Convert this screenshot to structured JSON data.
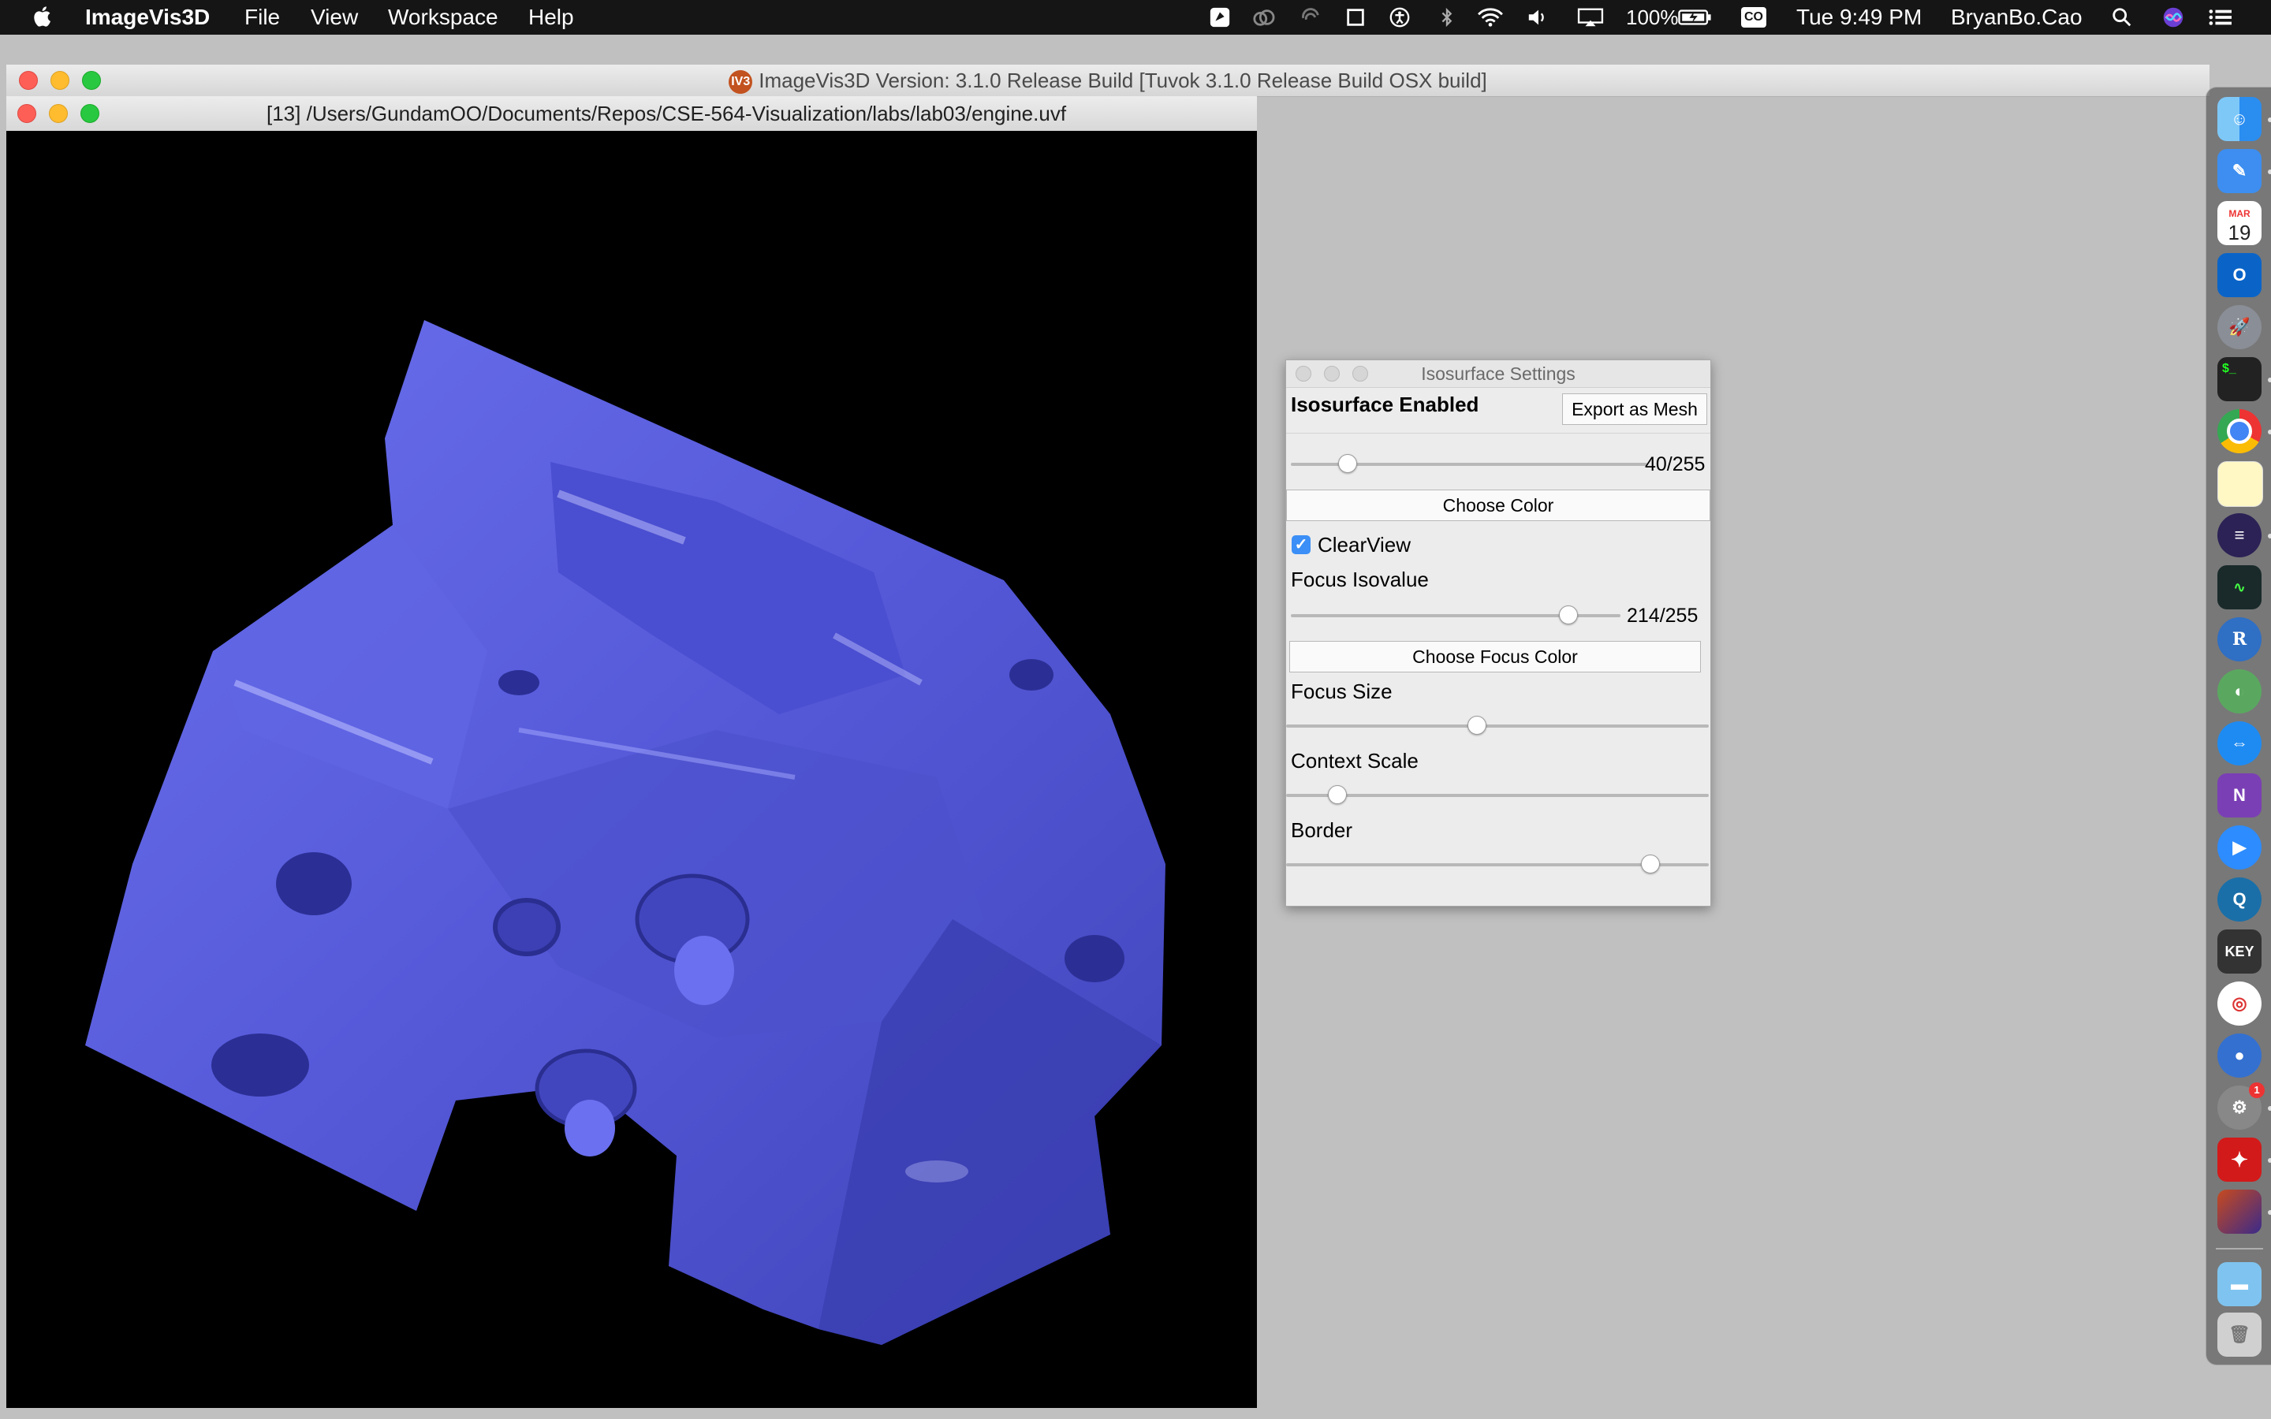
{
  "menubar": {
    "app_name": "ImageVis3D",
    "items": [
      "File",
      "View",
      "Workspace",
      "Help"
    ],
    "battery": "100%",
    "input_badge": "CO",
    "clock": "Tue 9:49 PM",
    "user": "BryanBo.Cao"
  },
  "main_window": {
    "title": "ImageVis3D Version: 3.1.0 Release Build [Tuvok 3.1.0 Release Build OSX build]",
    "logo_text": "IV3"
  },
  "render_window": {
    "title": "[13] /Users/GundamOO/Documents/Repos/CSE-564-Visualization/labs/lab03/engine.uvf",
    "surface_color": "#5b5fe0"
  },
  "iso_dialog": {
    "title": "Isosurface Settings",
    "enabled_label": "Isosurface Enabled",
    "export_button": "Export as Mesh",
    "isovalue": {
      "value": 40,
      "max": 255,
      "text": "40/255"
    },
    "choose_color": "Choose Color",
    "clearview_label": "ClearView",
    "clearview_checked": true,
    "focus_iso_label": "Focus Isovalue",
    "focus_isovalue": {
      "value": 214,
      "max": 255,
      "text": "214/255"
    },
    "choose_focus_color": "Choose Focus Color",
    "focus_size_label": "Focus Size",
    "focus_size_level": 0.45,
    "context_scale_label": "Context Scale",
    "context_scale_level": 0.12,
    "border_label": "Border",
    "border_level": 0.86
  },
  "dock": {
    "calendar_month": "MAR",
    "calendar_day": "19",
    "keynote_label": "KEY",
    "onenote_label": "N",
    "r_label": "R",
    "outlook_label": "O",
    "settings_badge": "1"
  }
}
